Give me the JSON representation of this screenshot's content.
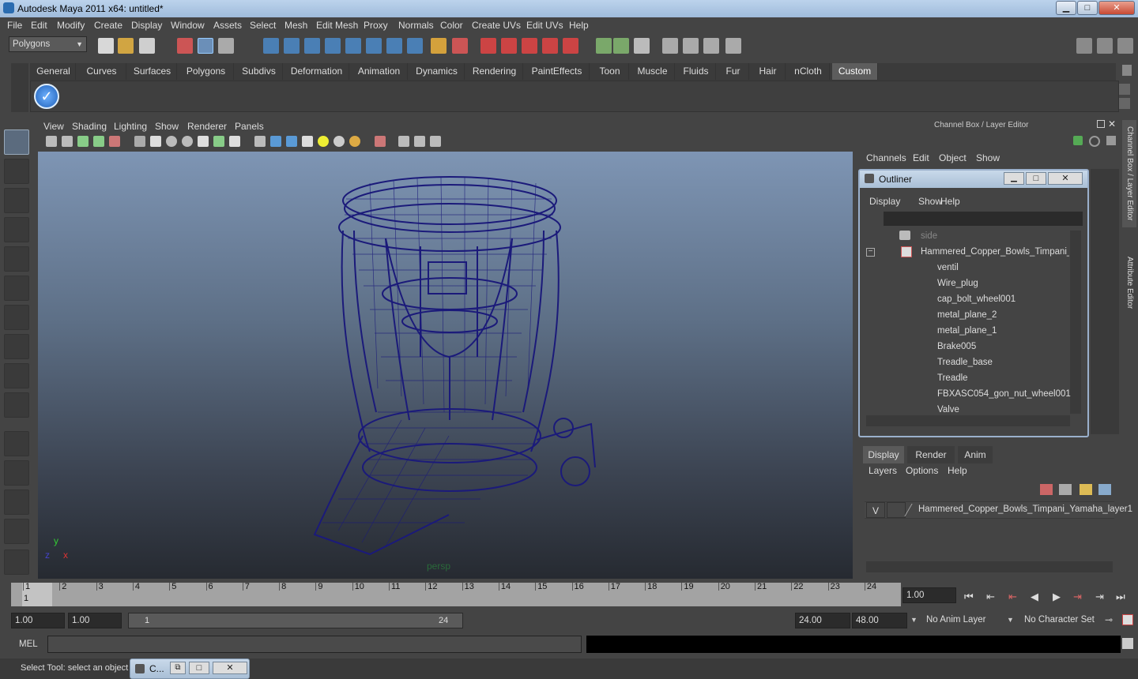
{
  "window": {
    "title": "Autodesk Maya 2011 x64: untitled*",
    "minimize": "▁",
    "maximize": "□",
    "close": "✕"
  },
  "menu": [
    "File",
    "Edit",
    "Modify",
    "Create",
    "Display",
    "Window",
    "Assets",
    "Select",
    "Mesh",
    "Edit Mesh",
    "Proxy",
    "Normals",
    "Color",
    "Create UVs",
    "Edit UVs",
    "Help"
  ],
  "mode_select": {
    "value": "Polygons"
  },
  "shelf_tabs": [
    "General",
    "Curves",
    "Surfaces",
    "Polygons",
    "Subdivs",
    "Deformation",
    "Animation",
    "Dynamics",
    "Rendering",
    "PaintEffects",
    "Toon",
    "Muscle",
    "Fluids",
    "Fur",
    "Hair",
    "nCloth",
    "Custom"
  ],
  "active_shelf_tab": "Custom",
  "panel_menu": [
    "View",
    "Shading",
    "Lighting",
    "Show",
    "Renderer",
    "Panels"
  ],
  "viewport": {
    "camera_label": "persp",
    "axis_x": "x",
    "axis_y": "y",
    "axis_z": "z"
  },
  "channel_box": {
    "title": "Channel Box / Layer Editor",
    "menu": [
      "Channels",
      "Edit",
      "Object",
      "Show"
    ]
  },
  "side_tabs": {
    "channel": "Channel Box / Layer Editor",
    "attribute": "Attribute Editor"
  },
  "outliner": {
    "title": "Outliner",
    "menu": [
      "Display",
      "Show",
      "Help"
    ],
    "items": [
      "side",
      "Hammered_Copper_Bowls_Timpani_Yar",
      "ventil",
      "Wire_plug",
      "cap_bolt_wheel001",
      "metal_plane_2",
      "metal_plane_1",
      "Brake005",
      "Treadle_base",
      "Treadle",
      "FBXASC054_gon_nut_wheel001",
      "Valve"
    ]
  },
  "layer_editor": {
    "tabs": [
      "Display",
      "Render",
      "Anim"
    ],
    "active_tab": "Display",
    "menu": [
      "Layers",
      "Options",
      "Help"
    ],
    "layer": {
      "visible": "V",
      "name": "Hammered_Copper_Bowls_Timpani_Yamaha_layer1"
    }
  },
  "timeline": {
    "ticks": [
      "1",
      "2",
      "3",
      "4",
      "5",
      "6",
      "7",
      "8",
      "9",
      "10",
      "11",
      "12",
      "13",
      "14",
      "15",
      "16",
      "17",
      "18",
      "19",
      "20",
      "21",
      "22",
      "23",
      "24"
    ],
    "current_frame": "1",
    "current_time": "1.00"
  },
  "range": {
    "start_time": "1.00",
    "playback_start": "1.00",
    "range_start": "1",
    "range_end": "24",
    "playback_end": "24.00",
    "end_time": "48.00",
    "anim_layer": "No Anim Layer",
    "character_set": "No Character Set"
  },
  "command_line": {
    "label": "MEL",
    "value": ""
  },
  "help_line": {
    "text": "Select Tool: select an object",
    "script_editor_label": "C..."
  }
}
